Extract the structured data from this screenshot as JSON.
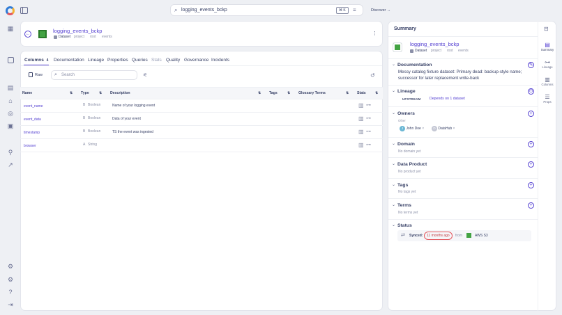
{
  "search": {
    "value": "logging_events_bckp",
    "shortcut": "⌘ K"
  },
  "discover_label": "Discover →",
  "entity": {
    "name": "logging_events_bckp",
    "type": "Dataset",
    "path": [
      "project",
      "root",
      "events"
    ]
  },
  "tabs": [
    {
      "label": "Columns",
      "count": "4"
    },
    {
      "label": "Documentation"
    },
    {
      "label": "Lineage"
    },
    {
      "label": "Properties"
    },
    {
      "label": "Queries"
    },
    {
      "label": "Stats"
    },
    {
      "label": "Quality"
    },
    {
      "label": "Governance"
    },
    {
      "label": "Incidents"
    }
  ],
  "toolbar": {
    "raw_label": "Raw",
    "search_placeholder": "Search"
  },
  "table": {
    "headers": {
      "name": "Name",
      "type": "Type",
      "description": "Description",
      "tags": "Tags",
      "glossary": "Glossary Terms",
      "stats": "Stats"
    },
    "rows": [
      {
        "name": "event_name",
        "type": "Boolean",
        "description": "Name of your logging event"
      },
      {
        "name": "event_data",
        "type": "Boolean",
        "description": "Data of your event"
      },
      {
        "name": "timestamp",
        "type": "Boolean",
        "description": "TS the event was ingested"
      },
      {
        "name": "browser",
        "type": "String",
        "description": ""
      }
    ]
  },
  "summary": {
    "title": "Summary",
    "entity_name": "logging_events_bckp",
    "entity_type": "Dataset",
    "path": [
      "project",
      "root",
      "events"
    ],
    "documentation": {
      "label": "Documentation",
      "text": "Messy catalog fixture dataset: Primary dead: backup-style name; successor for later replacement write-back"
    },
    "lineage": {
      "label": "Lineage",
      "upstream": "UPSTREAM",
      "depends": "Depends on 1 dataset"
    },
    "owners": {
      "label": "Owners",
      "group": "Other",
      "list": [
        {
          "initial": "J",
          "name": "John Doe"
        },
        {
          "initial": "D",
          "name": "DataHub"
        }
      ]
    },
    "domain": {
      "label": "Domain",
      "empty": "No domain yet"
    },
    "data_product": {
      "label": "Data Product",
      "empty": "No product yet"
    },
    "tags": {
      "label": "Tags",
      "empty": "No tags yet"
    },
    "terms": {
      "label": "Terms",
      "empty": "No terms yet"
    },
    "status": {
      "label": "Status",
      "synced": "Synced:",
      "ago": "11 months ago",
      "from": "from",
      "platform": "AWS S3"
    }
  },
  "right_nav": [
    {
      "label": "Summary"
    },
    {
      "label": "Lineage"
    },
    {
      "label": "Columns"
    },
    {
      "label": "Props"
    }
  ],
  "colors": {
    "accent": "#533fd1",
    "brand_green": "#43a343",
    "bg": "#eef0f4"
  }
}
